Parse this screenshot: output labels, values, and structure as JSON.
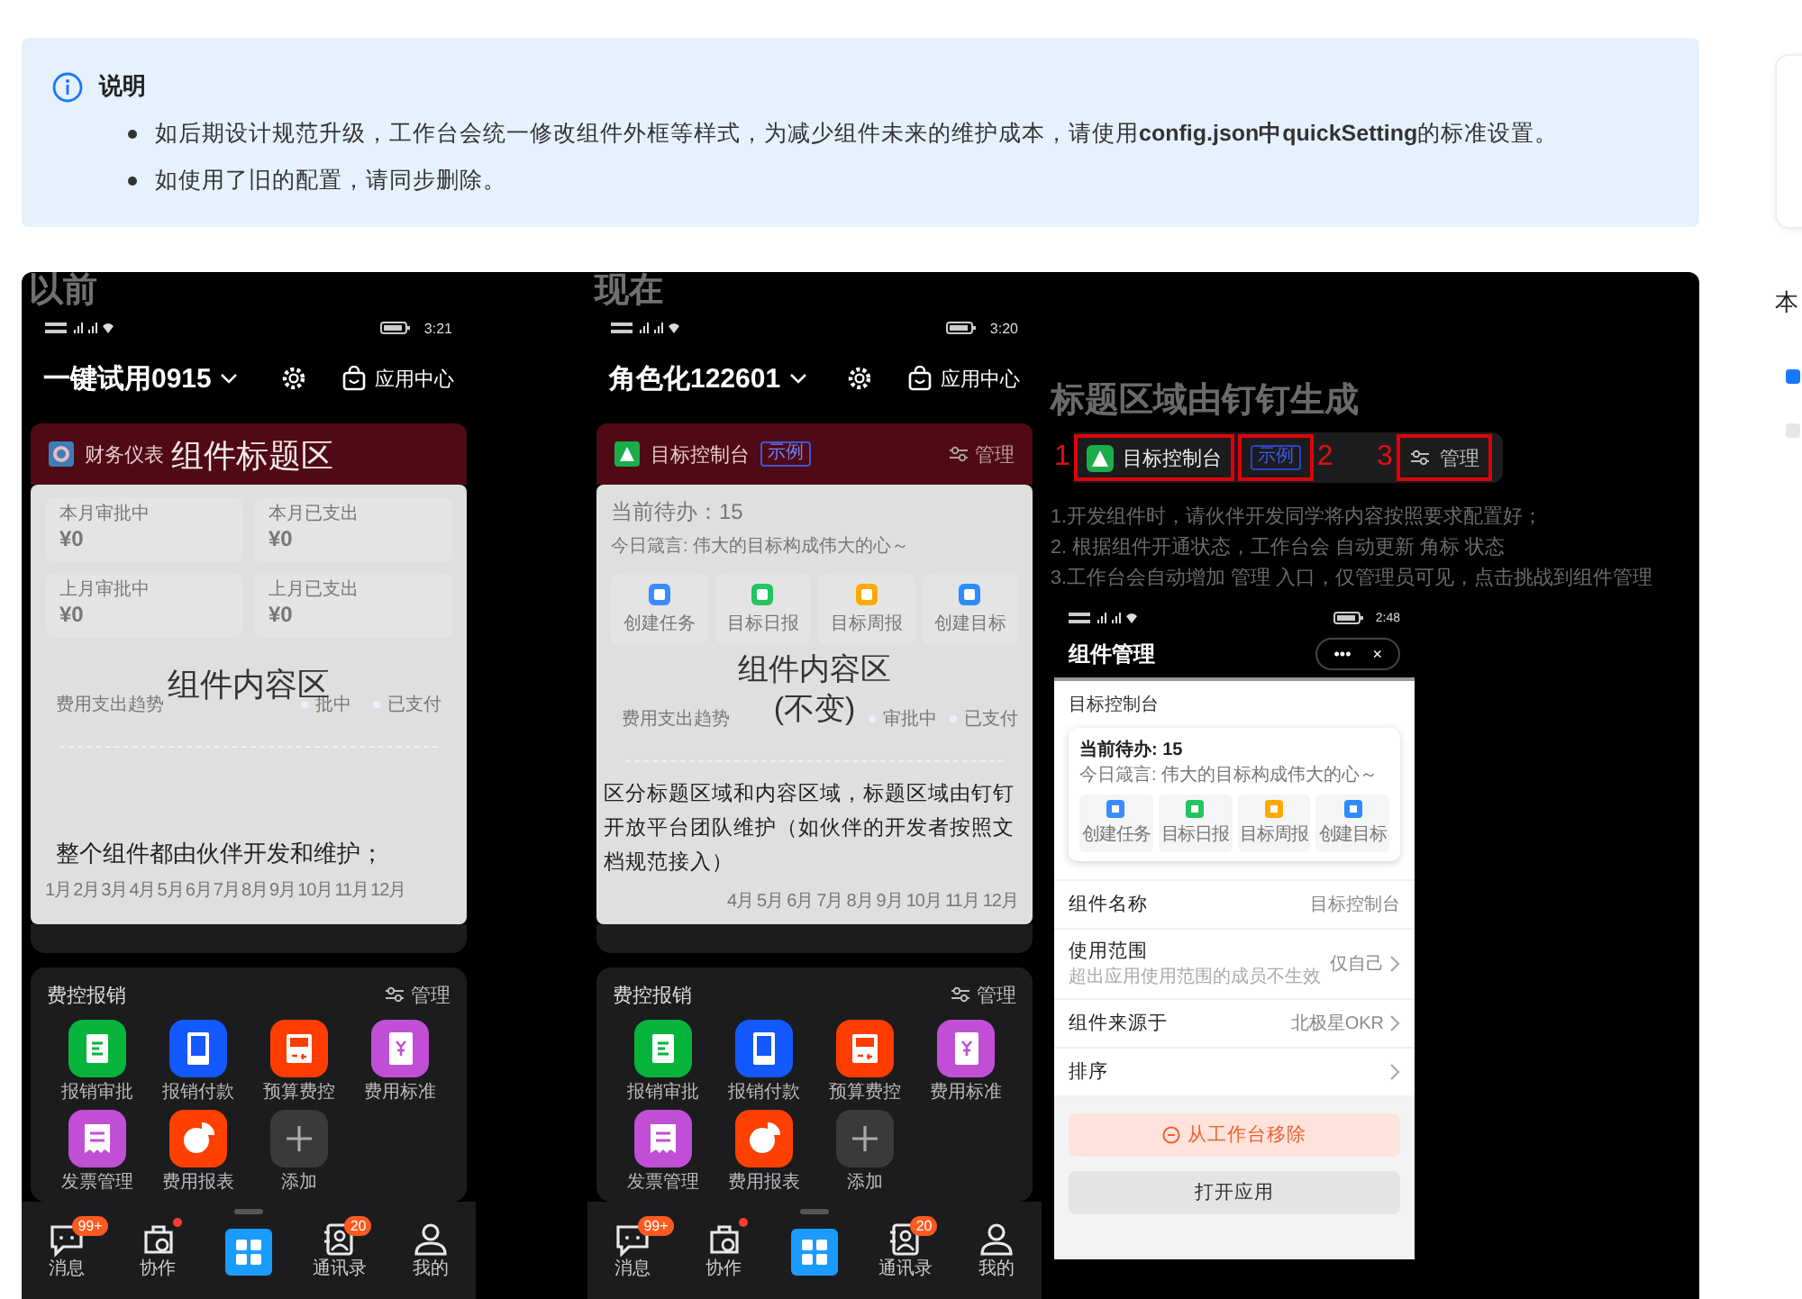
{
  "info_note": {
    "title": "说明",
    "bullets": [
      "如后期设计规范升级，工作台会统一修改组件外框等样式，为减少组件未来的维护成本，请使用**config.json中quickSetting**的标准设置。",
      "如使用了旧的配置，请同步删除。"
    ]
  },
  "demo": {
    "phones": [
      {
        "kind": "before",
        "label": "以前",
        "time": "3:21",
        "workspace": "一键试用0915",
        "app_center": "应用中心",
        "title_bar": {
          "name": "财务仪表",
          "overlay": "组件标题区"
        },
        "content": {
          "stats": [
            {
              "label": "本月审批中",
              "value": "¥0"
            },
            {
              "label": "本月已支出",
              "value": "¥0"
            },
            {
              "label": "上月审批中",
              "value": "¥0"
            },
            {
              "label": "上月已支出",
              "value": "¥0"
            }
          ],
          "chart_title": "费用支出趋势",
          "legend": [
            "批中",
            "已支付"
          ],
          "overlay": [
            "组件内容区"
          ],
          "note": "整个组件都由伙伴开发和维护；",
          "months": [
            "1月",
            "2月",
            "3月",
            "4月",
            "5月",
            "6月",
            "7月",
            "8月",
            "9月",
            "10月",
            "11月",
            "12月"
          ]
        },
        "card": {
          "title": "费控报销",
          "manage": "管理",
          "apps": [
            {
              "label": "报销审批",
              "kind": "doc",
              "color": "#06b43c"
            },
            {
              "label": "报销付款",
              "kind": "tablet",
              "color": "#1458ff"
            },
            {
              "label": "预算费控",
              "kind": "calc",
              "color": "#ff3d00"
            },
            {
              "label": "费用标准",
              "kind": "book",
              "color": "#c04fd6"
            },
            {
              "label": "发票管理",
              "kind": "receipt",
              "color": "#c04fd6"
            },
            {
              "label": "费用报表",
              "kind": "pie",
              "color": "#ff4000"
            },
            {
              "label": "添加",
              "kind": "add",
              "color": "#3a3a3c"
            }
          ]
        },
        "tabs": [
          {
            "kind": "chat",
            "label": "消息",
            "badge": "99+",
            "dot": false,
            "selected": false
          },
          {
            "kind": "work",
            "label": "协作",
            "dot": true,
            "selected": false
          },
          {
            "kind": "home",
            "dot": false,
            "selected": true
          },
          {
            "kind": "contacts",
            "label": "通讯录",
            "badge": "20",
            "dot": false,
            "selected": false
          },
          {
            "kind": "me",
            "label": "我的",
            "dot": false,
            "selected": false
          }
        ]
      },
      {
        "kind": "after",
        "label": "现在",
        "time": "3:20",
        "workspace": "角色化122601",
        "app_center": "应用中心",
        "title_bar": {
          "name": "目标控制台",
          "tag": "示例",
          "manage": "管理"
        },
        "content": {
          "todo": "当前待办：15",
          "motto": "今日箴言: 伟大的目标构成伟大的心～",
          "shortcuts": [
            {
              "label": "创建任务",
              "color": "#3c8cff"
            },
            {
              "label": "目标日报",
              "color": "#22c55e"
            },
            {
              "label": "目标周报",
              "color": "#ffaa00"
            },
            {
              "label": "创建目标",
              "color": "#2b8cff"
            }
          ],
          "chart_title": "费用支出趋势",
          "legend": [
            "审批中",
            "已支付"
          ],
          "overlay": [
            "组件内容区",
            "(不变)"
          ],
          "note": "区分标题区域和内容区域，标题区域由钉钉开放平台团队维护（如伙伴的开发者按照文档规范接入）",
          "months": [
            "4月",
            "5月",
            "6月",
            "7月",
            "8月",
            "9月",
            "10月",
            "11月",
            "12月"
          ]
        },
        "card": {
          "title": "费控报销",
          "manage": "管理",
          "apps": [
            {
              "label": "报销审批",
              "kind": "doc",
              "color": "#06b43c"
            },
            {
              "label": "报销付款",
              "kind": "tablet",
              "color": "#1458ff"
            },
            {
              "label": "预算费控",
              "kind": "calc",
              "color": "#ff3d00"
            },
            {
              "label": "费用标准",
              "kind": "book",
              "color": "#c04fd6"
            },
            {
              "label": "发票管理",
              "kind": "receipt",
              "color": "#c04fd6"
            },
            {
              "label": "费用报表",
              "kind": "pie",
              "color": "#ff4000"
            },
            {
              "label": "添加",
              "kind": "add",
              "color": "#3a3a3c"
            }
          ]
        },
        "tabs": [
          {
            "kind": "chat",
            "label": "消息",
            "badge": "99+",
            "dot": false,
            "selected": false
          },
          {
            "kind": "work",
            "label": "协作",
            "dot": true,
            "selected": false
          },
          {
            "kind": "home",
            "dot": false,
            "selected": true
          },
          {
            "kind": "contacts",
            "label": "通讯录",
            "badge": "20",
            "dot": false,
            "selected": false
          },
          {
            "kind": "me",
            "label": "我的",
            "dot": false,
            "selected": false
          }
        ]
      }
    ],
    "spec": {
      "heading": "标题区域由钉钉生成",
      "callouts": [
        {
          "number": "1",
          "kind": "name",
          "text": "目标控制台"
        },
        {
          "number": "2",
          "kind": "tag",
          "text": "示例"
        },
        {
          "number": "3",
          "kind": "manage",
          "text": "管理"
        }
      ],
      "steps": [
        "1.开发组件时，请伙伴开发同学将内容按照要求配置好；",
        "2. 根据组件开通状态，工作台会 自动更新 角标 状态",
        "3.工作台会自动增加 管理 入口，仅管理员可见，点击挑战到组件管理"
      ],
      "screenshot": {
        "time": "2:48",
        "title": "组件管理",
        "more": "•••",
        "close": "×",
        "section": "目标控制台",
        "preview": {
          "todo": "当前待办: 15",
          "motto": "今日箴言: 伟大的目标构成伟大的心～",
          "shortcuts": [
            {
              "label": "创建任务",
              "color": "#3c8cff"
            },
            {
              "label": "目标日报",
              "color": "#22c55e"
            },
            {
              "label": "目标周报",
              "color": "#ffaa00"
            },
            {
              "label": "创建目标",
              "color": "#2b8cff"
            }
          ]
        },
        "rows": [
          {
            "label": "组件名称",
            "value": "目标控制台",
            "chevron": false
          },
          {
            "label": "使用范围",
            "hint": "超出应用使用范围的成员不生效",
            "value": "仅自己",
            "chevron": true
          },
          {
            "label": "组件来源于",
            "value": "北极星OKR",
            "chevron": true
          },
          {
            "label": "排序",
            "chevron": true
          }
        ],
        "buttons": [
          {
            "kind": "danger",
            "label": "从工作台移除"
          },
          {
            "kind": "plain",
            "label": "打开应用"
          }
        ]
      }
    }
  },
  "side_rail": {
    "heading": "本",
    "items": [
      {
        "selected": true
      },
      {
        "selected": false
      }
    ]
  }
}
